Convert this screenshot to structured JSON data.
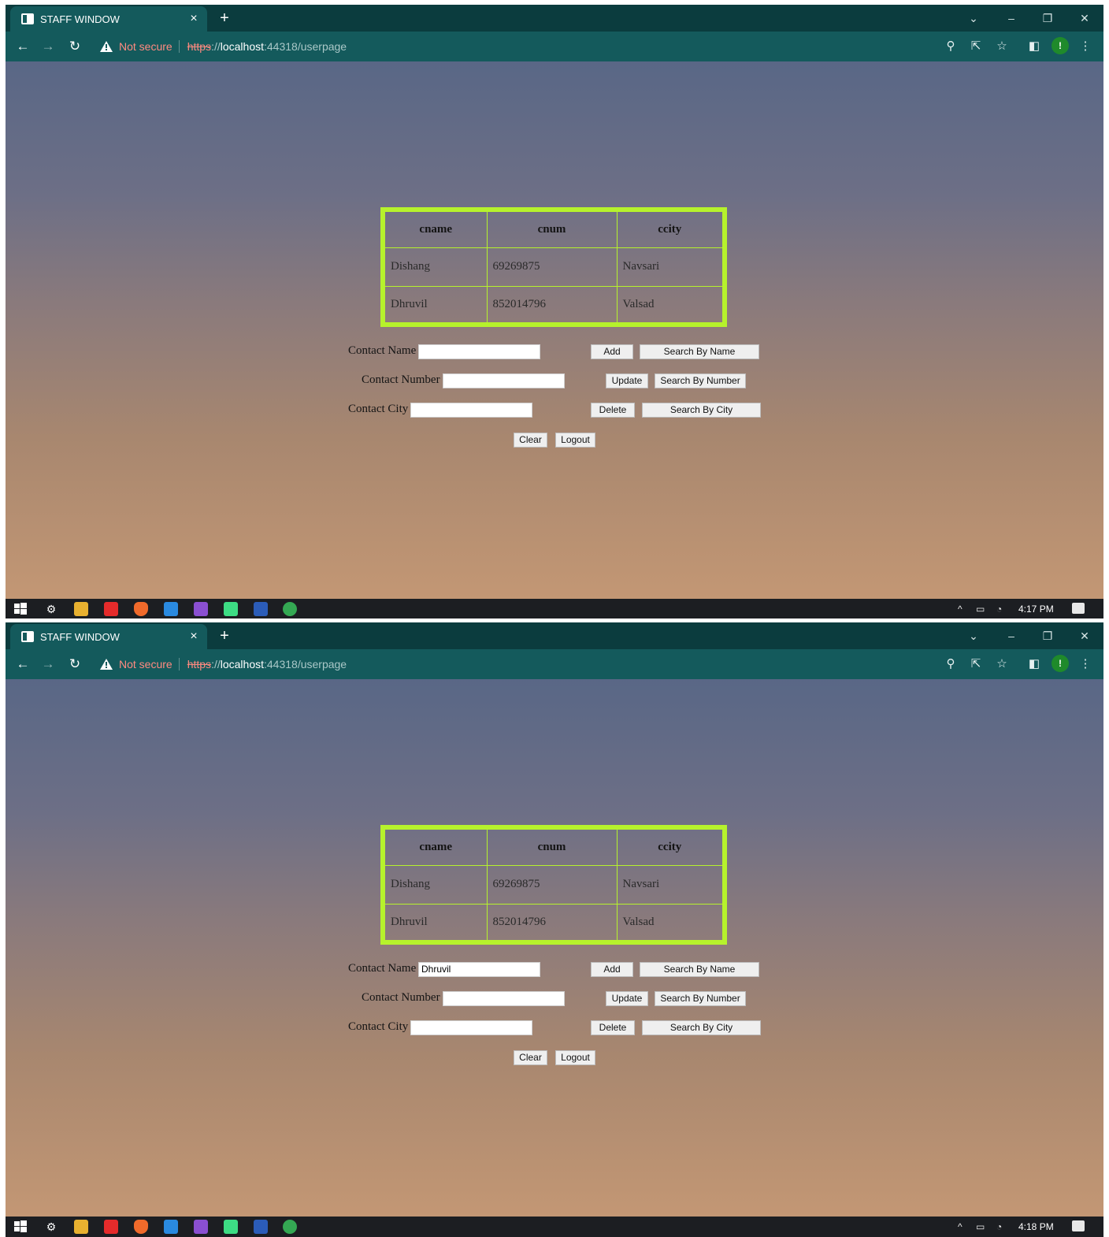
{
  "browser": {
    "tab_title": "STAFF WINDOW",
    "close_tab_glyph": "×",
    "new_tab_glyph": "+",
    "security_text": "Not secure",
    "url_protocol": "https",
    "url_sep": "://",
    "url_host": "localhost",
    "url_rest": ":44318/userpage"
  },
  "table": {
    "headers": [
      "cname",
      "cnum",
      "ccity"
    ],
    "rows": [
      [
        "Dishang",
        "69269875",
        "Navsari"
      ],
      [
        "Dhruvil",
        "852014796",
        "Valsad"
      ]
    ]
  },
  "form": {
    "name_label": "Contact Name",
    "number_label": "Contact Number",
    "city_label": "Contact City"
  },
  "buttons": {
    "add": "Add",
    "search_name": "Search By Name",
    "update": "Update",
    "search_number": "Search By Number",
    "delete": "Delete",
    "search_city": "Search By City",
    "clear": "Clear",
    "logout": "Logout"
  },
  "shots": [
    {
      "name_value": "",
      "clock": "4:17 PM"
    },
    {
      "name_value": "Dhruvil",
      "clock": "4:18 PM"
    }
  ],
  "colors": {
    "table_border": "#b6f22c",
    "chrome_bg": "#0b3c3e",
    "toolbar_bg": "#145a5c",
    "warning": "#ff8a80"
  },
  "icons": [
    "back-arrow-icon",
    "forward-arrow-icon",
    "reload-icon",
    "warning-icon",
    "zoom-icon",
    "share-icon",
    "star-icon",
    "sidepanel-icon",
    "extension-icon",
    "menu-icon",
    "windows-start-icon"
  ]
}
